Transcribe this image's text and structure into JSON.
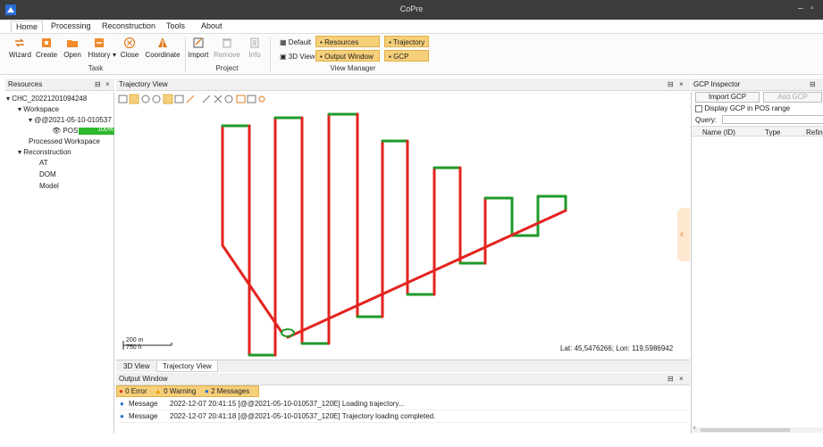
{
  "app": {
    "title": "CoPre"
  },
  "menu": {
    "tabs": [
      "Home",
      "Processing",
      "Reconstruction",
      "Tools",
      "About"
    ]
  },
  "ribbon": {
    "task_buttons": [
      "Wizard",
      "Create",
      "Open",
      "History",
      "Close",
      "Coordinate"
    ],
    "task_label": "Task",
    "project_buttons": [
      "Import",
      "Remove",
      "Info"
    ],
    "project_label": "Project",
    "view_manager": [
      "Default",
      "3D View",
      "Resources",
      "Output Window",
      "Trajectory",
      "GCP"
    ],
    "view_manager_label": "View Manager"
  },
  "resources": {
    "title": "Resources",
    "tree": [
      "CHC_20221201094248",
      "Workspace",
      "@@2021-05-10-010537",
      "POS",
      "100%",
      "Processed Workspace",
      "Reconstruction",
      "AT",
      "DOM",
      "Model"
    ],
    "pos_progress": 1.0
  },
  "trajectory": {
    "title": "Trajectory View",
    "scale_top": "200 m",
    "scale_bottom": "750 ft",
    "coords": "Lat: 45,5476266; Lon: 119,5986942",
    "tabs": [
      "3D View",
      "Trajectory View"
    ]
  },
  "output": {
    "title": "Output Window",
    "filters": {
      "error": "0 Error",
      "warning": "0 Warning",
      "messages": "2 Messages"
    },
    "rows": [
      {
        "type": "Message",
        "text": "2022-12-07 20:41:15  [@@2021-05-10-010537_120E] Loading trajectory..."
      },
      {
        "type": "Message",
        "text": "2022-12-07 20:41:18  [@@2021-05-10-010537_120E] Trajectory loading completed."
      }
    ]
  },
  "gcp": {
    "title": "GCP Inspector",
    "import_label": "Import GCP",
    "add_label": "Add GCP",
    "display_label": "Display GCP in POS range",
    "query_label": "Query:",
    "columns": [
      "Name (ID)",
      "Type",
      "Refin"
    ]
  },
  "colors": {
    "accent": "#f6cf7a",
    "track_red": "#e3231e",
    "track_green": "#1f9a2a"
  }
}
